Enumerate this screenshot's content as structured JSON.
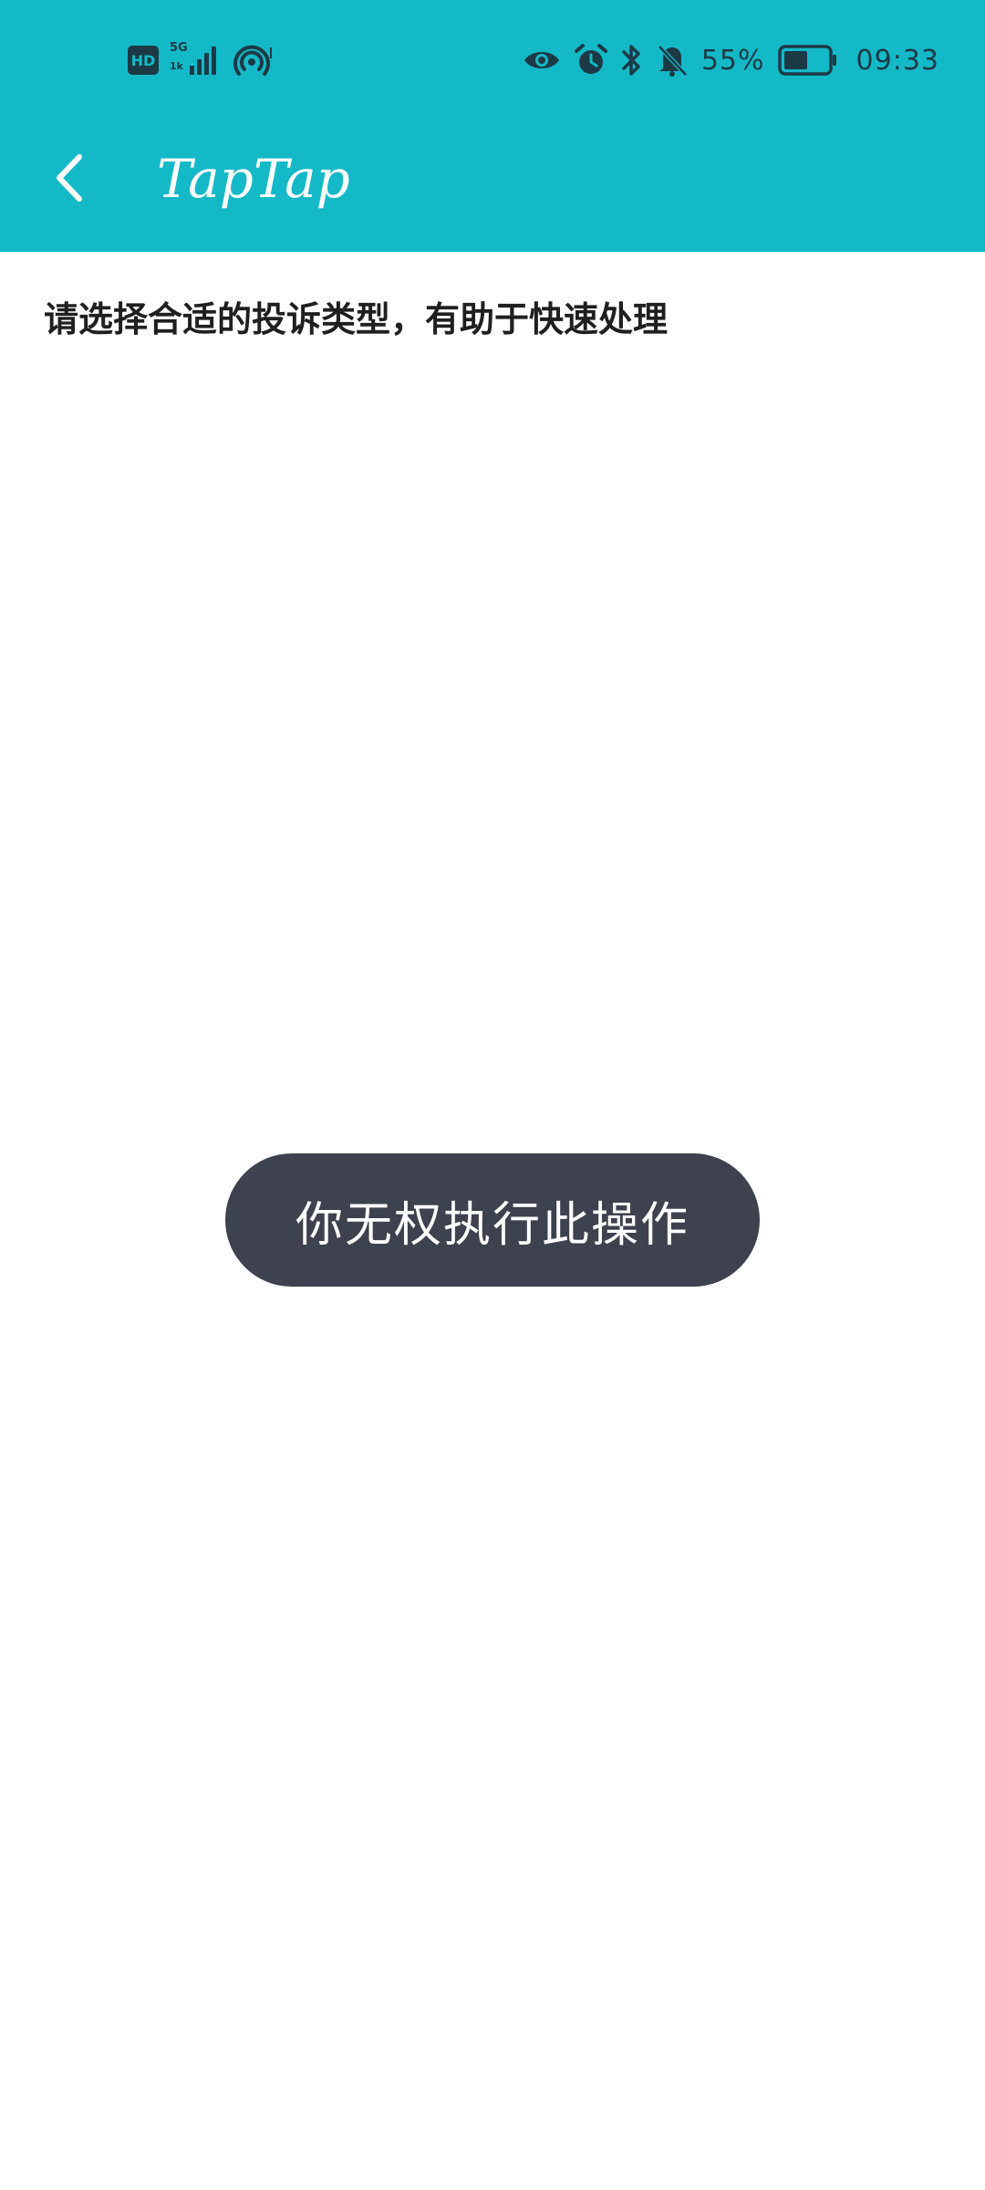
{
  "status_bar": {
    "hd_label": "HD",
    "network_type": "5G",
    "speed_label": "1k",
    "battery_percent": "55%",
    "battery_level": 0.55,
    "time": "09:33",
    "icons": [
      "hd-icon",
      "signal-icon",
      "hotspot-icon",
      "eye-icon",
      "alarm-icon",
      "bluetooth-icon",
      "mute-bell-icon",
      "battery-icon"
    ],
    "color": "#1c3a45"
  },
  "app_bar": {
    "title": "TapTap",
    "back_icon": "chevron-left-icon",
    "background_color": "#14b9c8"
  },
  "content": {
    "prompt": "请选择合适的投诉类型，有助于快速处理"
  },
  "toast": {
    "message": "你无权执行此操作",
    "background_color": "#3e424f"
  }
}
